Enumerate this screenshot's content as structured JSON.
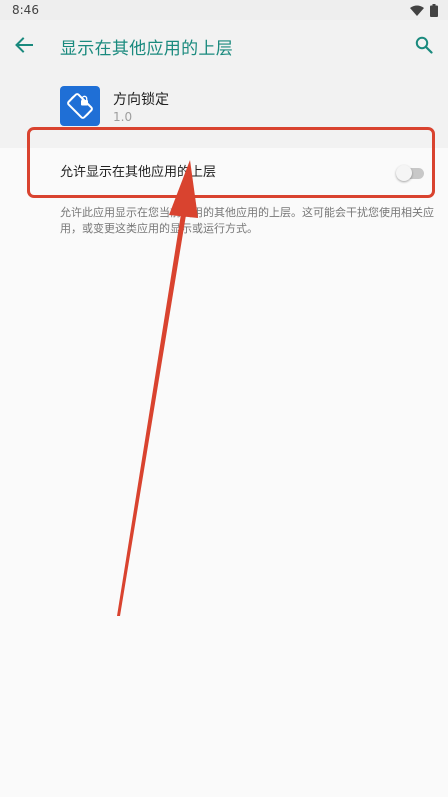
{
  "status_bar": {
    "time": "8:46",
    "icons": [
      "wifi-icon",
      "battery-icon"
    ]
  },
  "app_bar": {
    "title": "显示在其他应用的上层",
    "back_icon": "arrow-left-icon",
    "search_icon": "search-icon",
    "accent_color": "#1a8a7e"
  },
  "app_info": {
    "name": "方向锁定",
    "version": "1.0",
    "icon": "rotation-lock-icon",
    "icon_color": "#1f6fd6"
  },
  "setting": {
    "label": "允许显示在其他应用的上层",
    "enabled": false,
    "description": "允许此应用显示在您当前使用的其他应用的上层。这可能会干扰您使用相关应用，或变更这类应用的显示或运行方式。"
  },
  "annotation": {
    "color": "#d9432f"
  }
}
